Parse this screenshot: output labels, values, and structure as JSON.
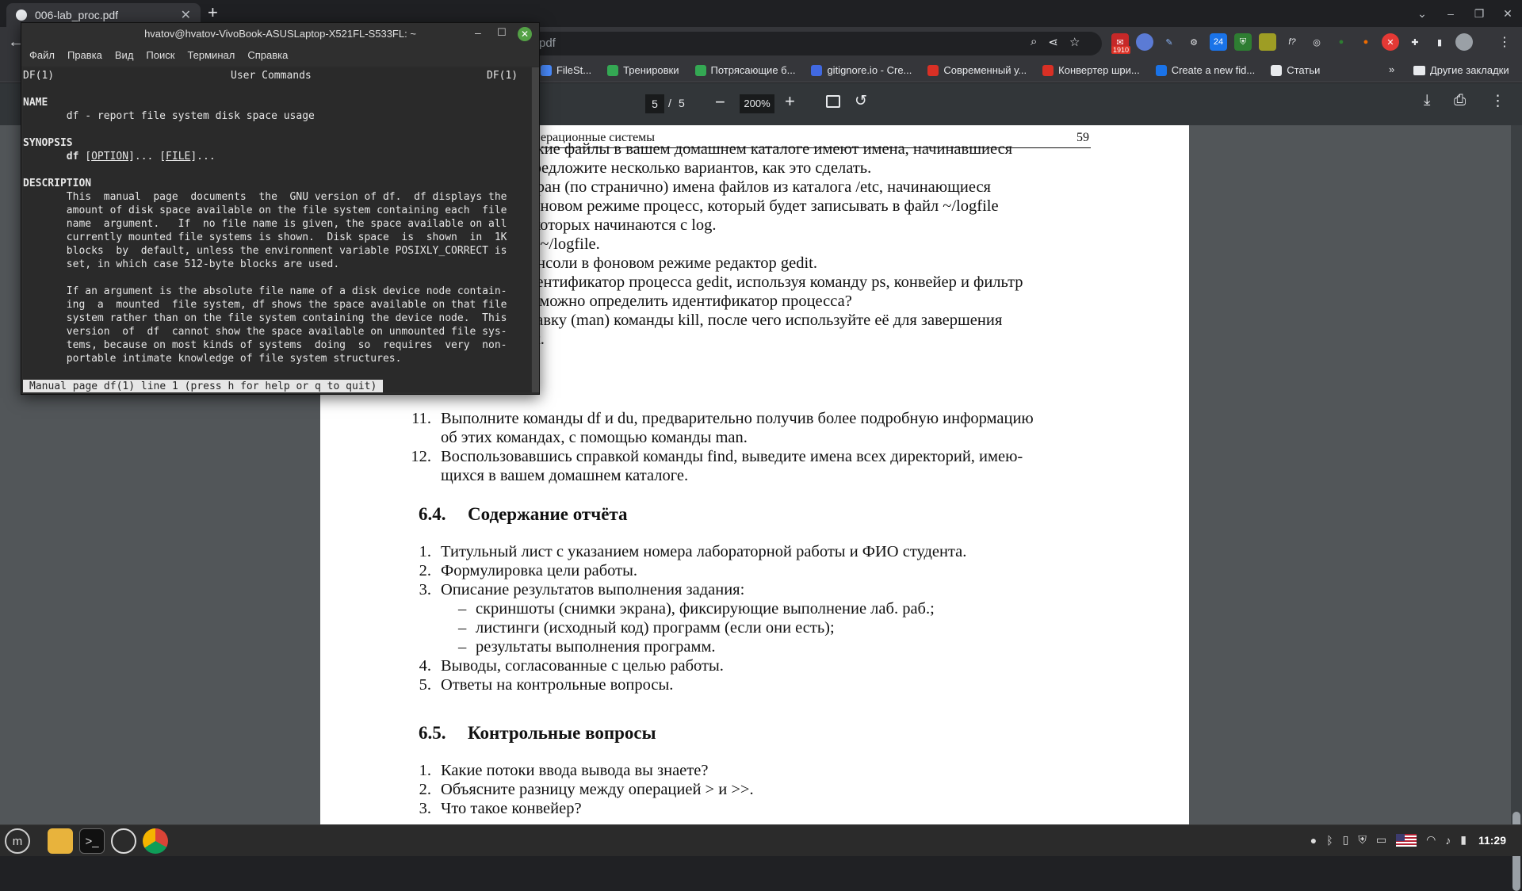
{
  "browser": {
    "tab_title": "006-lab_proc.pdf",
    "new_tab": "+",
    "omnibox_text": "pdf",
    "extension_badge": "1910",
    "bookmarks": [
      {
        "label": "FileSt...",
        "color": "#4a8cff"
      },
      {
        "label": "Тренировки",
        "color": "#34a853"
      },
      {
        "label": "Потрясающие б...",
        "color": "#34a853"
      },
      {
        "label": "gitignore.io - Cre...",
        "color": "#4169e1"
      },
      {
        "label": "Современный у...",
        "color": "#d93025"
      },
      {
        "label": "Конвертер шри...",
        "color": "#d93025"
      },
      {
        "label": "Create a new fid...",
        "color": "#1a73e8"
      },
      {
        "label": "Статьи",
        "color": "#e8eaed"
      }
    ],
    "bookmarks_more": "»",
    "other_bookmarks": "Другие закладки"
  },
  "pdf": {
    "page_current": "5",
    "page_sep": "/",
    "page_total": "5",
    "zoom": "200%",
    "running_title": "ерационные системы",
    "running_page": "59",
    "task_lines": [
      "какие файлы в вашем домашнем каталоге имеют имена, начинавшиеся",
      "Предложите несколько вариантов, как это сделать.",
      "экран (по странично) имена файлов из каталога /etc, начинающиеся",
      "фоновом режиме процесс, который будет записывать в файл ~/logfile",
      "а которых начинаются с log.",
      "л ~/logfile.",
      "консоли в фоновом режиме редактор gedit.",
      "дентификатор процесса gedit, используя команду ps, конвейер и фильтр",
      "ё можно определить идентификатор процесса?",
      "равку (man) команды kill, после чего используйте её для завершения",
      "процесса gedit."
    ],
    "task_11_num": "11.",
    "task_11_line1": "Выполните команды df и du, предварительно получив более подробную информацию",
    "task_11_line2": "об этих командах, с помощью команды man.",
    "task_12_num": "12.",
    "task_12_line1": "Воспользовавшись справкой команды find, выведите имена всех директорий, имею-",
    "task_12_line2": "щихся в вашем домашнем каталоге.",
    "section_64_num": "6.4.",
    "section_64_title": "Содержание отчёта",
    "report_items": [
      {
        "num": "1.",
        "text": "Титульный лист с указанием номера лабораторной работы и ФИО студента."
      },
      {
        "num": "2.",
        "text": "Формулировка цели работы."
      },
      {
        "num": "3.",
        "text": "Описание результатов выполнения задания:"
      }
    ],
    "report_subitems": [
      "скриншоты (снимки экрана), фиксирующие выполнение лаб. раб.;",
      "листинги (исходный код) программ (если они есть);",
      "результаты выполнения программ."
    ],
    "report_items_tail": [
      {
        "num": "4.",
        "text": "Выводы, согласованные с целью работы."
      },
      {
        "num": "5.",
        "text": "Ответы на контрольные вопросы."
      }
    ],
    "dash": "–",
    "section_65_num": "6.5.",
    "section_65_title": "Контрольные вопросы",
    "questions": [
      {
        "num": "1.",
        "text": "Какие потоки ввода вывода вы знаете?"
      },
      {
        "num": "2.",
        "text": "Объясните разницу между операцией > и >>."
      },
      {
        "num": "3.",
        "text": "Что такое конвейер?"
      }
    ]
  },
  "terminal": {
    "title": "hvatov@hvatov-VivoBook-ASUSLaptop-X521FL-S533FL: ~",
    "menu": [
      "Файл",
      "Правка",
      "Вид",
      "Поиск",
      "Терминал",
      "Справка"
    ],
    "header_left": "DF(1)",
    "header_center": "User Commands",
    "header_right": "DF(1)",
    "name_heading": "NAME",
    "name_text": "       df - report file system disk space usage",
    "synopsis_heading": "SYNOPSIS",
    "synopsis_cmd": "df",
    "synopsis_option": "OPTION",
    "synopsis_file": "FILE",
    "description_heading": "DESCRIPTION",
    "desc_lines": [
      "       This  manual  page  documents  the  GNU version of df.  df displays the",
      "       amount of disk space available on the file system containing each  file",
      "       name  argument.   If  no file name is given, the space available on all",
      "       currently mounted file systems is shown.  Disk space  is  shown  in  1K",
      "       blocks  by  default, unless the environment variable POSIXLY_CORRECT is",
      "       set, in which case 512-byte blocks are used.",
      "",
      "       If an argument is the absolute file name of a disk device node contain-",
      "       ing  a  mounted  file system, df shows the space available on that file",
      "       system rather than on the file system containing the device node.  This",
      "       version  of  df  cannot show the space available on unmounted file sys-",
      "       tems, because on most kinds of systems  doing  so  requires  very  non-",
      "       portable intimate knowledge of file system structures."
    ],
    "status_line": "Manual page df(1) line 1 (press h for help or q to quit)"
  },
  "taskbar": {
    "clock": "11:29"
  }
}
